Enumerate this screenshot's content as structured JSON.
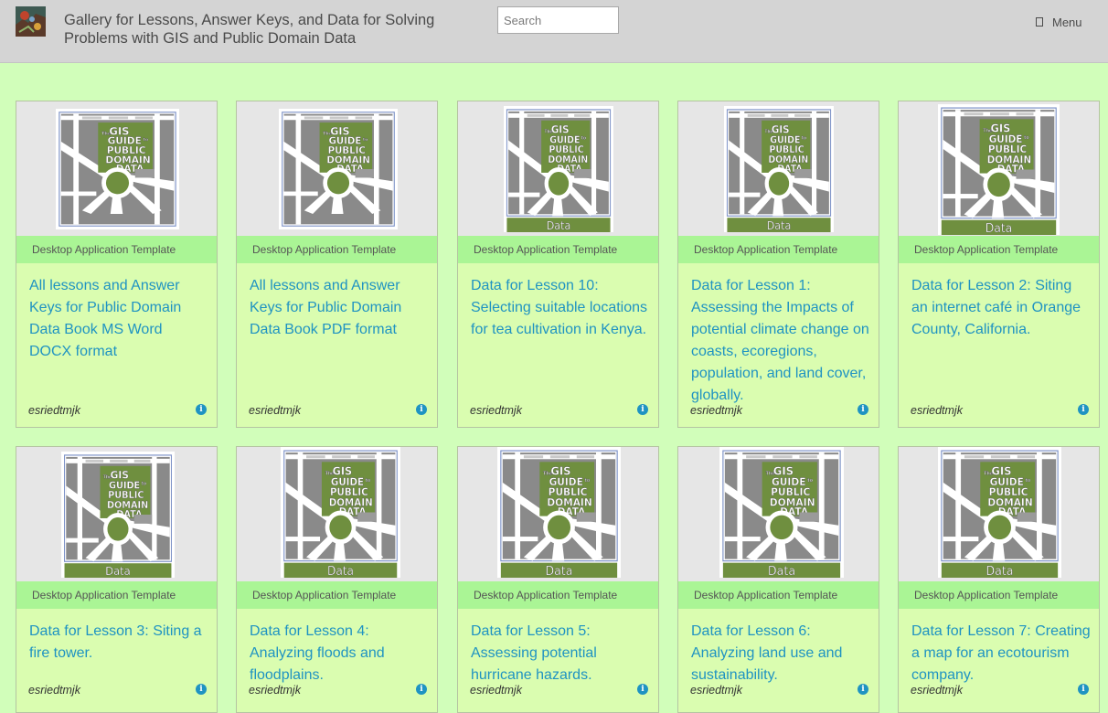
{
  "header": {
    "title": "Gallery for Lessons, Answer Keys, and Data for Solving Problems with GIS and Public Domain Data",
    "search_placeholder": "Search",
    "menu_label": "Menu"
  },
  "thumbnail_text": {
    "cover_line1": "The",
    "cover_line2": "GIS",
    "cover_line3": "GUIDE",
    "cover_line4": "to",
    "cover_line5": "PUBLIC",
    "cover_line6": "DOMAIN",
    "cover_line7": "DATA",
    "data_banner": "Data"
  },
  "cards": [
    {
      "type_label": "Desktop Application Template",
      "title": "All lessons and Answer Keys for Public Domain Data Book MS Word DOCX format",
      "owner": "esriedtmjk",
      "has_data_banner": false
    },
    {
      "type_label": "Desktop Application Template",
      "title": "All lessons and Answer Keys for Public Domain Data Book PDF format",
      "owner": "esriedtmjk",
      "has_data_banner": false
    },
    {
      "type_label": "Desktop Application Template",
      "title": "Data for Lesson 10: Selecting suitable locations for tea cultivation in Kenya.",
      "owner": "esriedtmjk",
      "has_data_banner": true
    },
    {
      "type_label": "Desktop Application Template",
      "title": "Data for Lesson 1: Assessing the Impacts of potential climate change on coasts, ecoregions, population, and land cover, globally.",
      "owner": "esriedtmjk",
      "has_data_banner": true
    },
    {
      "type_label": "Desktop Application Template",
      "title": "Data for Lesson 2: Siting an internet café in Orange County, California.",
      "owner": "esriedtmjk",
      "has_data_banner": true
    },
    {
      "type_label": "Desktop Application Template",
      "title": "Data for Lesson 3: Siting a fire tower.",
      "owner": "esriedtmjk",
      "has_data_banner": true
    },
    {
      "type_label": "Desktop Application Template",
      "title": "Data for Lesson 4: Analyzing floods and floodplains.",
      "owner": "esriedtmjk",
      "has_data_banner": true
    },
    {
      "type_label": "Desktop Application Template",
      "title": "Data for Lesson 5: Assessing potential hurricane hazards.",
      "owner": "esriedtmjk",
      "has_data_banner": true
    },
    {
      "type_label": "Desktop Application Template",
      "title": "Data for Lesson 6: Analyzing land use and sustainability.",
      "owner": "esriedtmjk",
      "has_data_banner": true
    },
    {
      "type_label": "Desktop Application Template",
      "title": "Data for Lesson 7: Creating a map for an ecotourism company.",
      "owner": "esriedtmjk",
      "has_data_banner": true
    }
  ],
  "icons": {
    "logo": "gallery-logo-icon",
    "menu": "menu-icon",
    "info": "info-icon"
  },
  "colors": {
    "page_background": "#d1feba",
    "header_background": "#d4d4d4",
    "card_background": "#dafdb0",
    "type_band": "#aaf595",
    "link": "#1f93c2",
    "cover_green": "#6f8f3f"
  }
}
